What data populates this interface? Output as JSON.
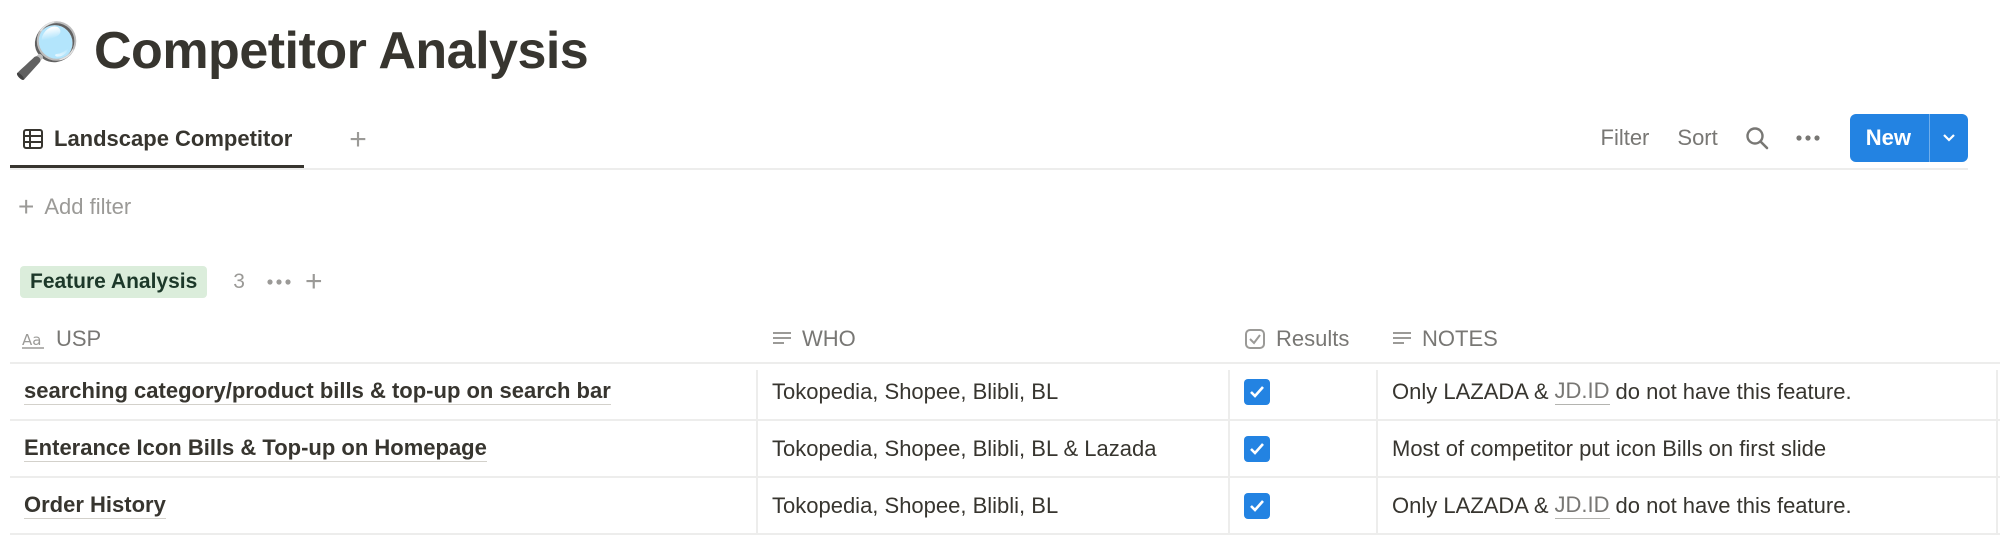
{
  "page": {
    "emoji": "🔎",
    "title": "Competitor Analysis"
  },
  "view": {
    "tab_label": "Landscape Competitor",
    "filter_label": "Filter",
    "sort_label": "Sort",
    "new_label": "New"
  },
  "add_filter_label": "Add filter",
  "group": {
    "label": "Feature Analysis",
    "count": "3"
  },
  "columns": {
    "usp": "USP",
    "who": "WHO",
    "results": "Results",
    "notes": "NOTES"
  },
  "rows": [
    {
      "usp": "searching category/product bills & top-up on search bar",
      "who": "Tokopedia, Shopee, Blibli, BL",
      "results": true,
      "notes_before": "Only LAZADA &",
      "notes_link": "JD.ID",
      "notes_after": "do not have this feature."
    },
    {
      "usp": "Enterance Icon Bills & Top-up on Homepage",
      "who": "Tokopedia, Shopee, Blibli, BL & Lazada",
      "results": true,
      "notes": "Most of competitor put icon Bills on first slide"
    },
    {
      "usp": "Order History",
      "who": "Tokopedia, Shopee, Blibli, BL",
      "results": true,
      "notes_before": "Only LAZADA &",
      "notes_link": "JD.ID",
      "notes_after": "do not have this feature."
    }
  ],
  "colors": {
    "accent": "#2383e2",
    "group_tag_bg": "#dbeddb",
    "text": "#37352f",
    "muted": "#787774"
  },
  "icons": {
    "title": "magnifying-glass-emoji",
    "tab": "table-icon",
    "search": "search-icon",
    "more": "more-icon",
    "caret": "chevron-down-icon",
    "usp": "title-property-icon",
    "who": "text-property-icon",
    "results": "checkbox-property-icon",
    "notes": "text-property-icon"
  }
}
